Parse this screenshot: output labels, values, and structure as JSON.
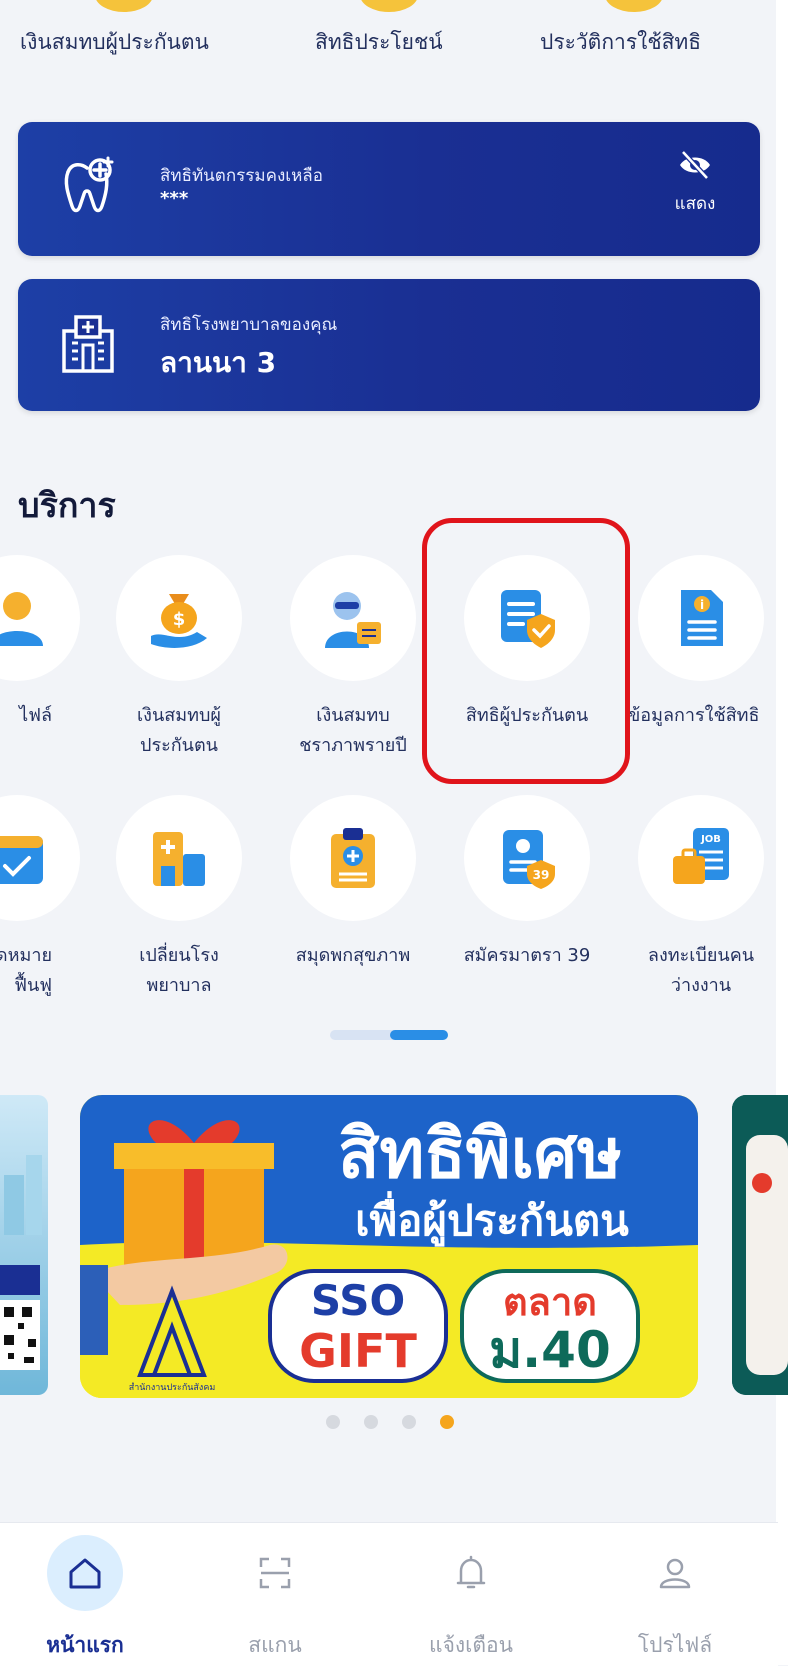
{
  "top_tabs": [
    {
      "label": "เงินสมทบผู้ประกันตน"
    },
    {
      "label": "สิทธิประโยชน์"
    },
    {
      "label": "ประวัติการใช้สิทธิ"
    }
  ],
  "dental_card": {
    "title": "สิทธิทันตกรรมคงเหลือ",
    "value": "***",
    "toggle_label": "แสดง"
  },
  "hospital_card": {
    "title": "สิทธิโรงพยาบาลของคุณ",
    "value": "ลานนา 3"
  },
  "services": {
    "title": "บริการ",
    "row1": [
      {
        "label": "ไฟล์",
        "icon": "profile-icon"
      },
      {
        "label": "เงินสมทบผู้\nประกันตน",
        "icon": "money-bag-icon"
      },
      {
        "label": "เงินสมทบ\nชราภาพรายปี",
        "icon": "elderly-pension-icon"
      },
      {
        "label": "สิทธิผู้ประกันตน",
        "icon": "insured-rights-icon"
      },
      {
        "label": "ข้อมูลการใช้สิทธิ",
        "icon": "info-document-icon"
      }
    ],
    "row2": [
      {
        "label": "นัดหมาย\nฟื้นฟู",
        "icon": "calendar-icon"
      },
      {
        "label": "เปลี่ยนโรง\nพยาบาล",
        "icon": "hospital-icon"
      },
      {
        "label": "สมุดพกสุขภาพ",
        "icon": "health-clipboard-icon"
      },
      {
        "label": "สมัครมาตรา 39",
        "icon": "section-39-icon"
      },
      {
        "label": "ลงทะเบียนคน\nว่างงาน",
        "icon": "job-icon"
      }
    ]
  },
  "banner": {
    "headline": "สิทธิพิเศษ",
    "subline": "เพื่อผู้ประกันตน",
    "badge1_line1": "SSO",
    "badge1_line2": "GIFT",
    "badge2_line1": "ตลาด",
    "badge2_line2": "ม.40",
    "logo_caption": "สำนักงานประกันสังคม",
    "total_slides": 4,
    "active_slide": 4
  },
  "bottom_nav": [
    {
      "label": "หน้าแรก",
      "icon": "home-icon",
      "active": true
    },
    {
      "label": "สแกน",
      "icon": "scan-icon",
      "active": false
    },
    {
      "label": "แจ้งเตือน",
      "icon": "bell-icon",
      "active": false
    },
    {
      "label": "โปรไฟล์",
      "icon": "user-icon",
      "active": false
    }
  ],
  "colors": {
    "card_blue": "#1a2f93",
    "accent_yellow": "#f5c33b",
    "highlight_red": "#e0141b",
    "active_nav": "#1a2f93"
  }
}
